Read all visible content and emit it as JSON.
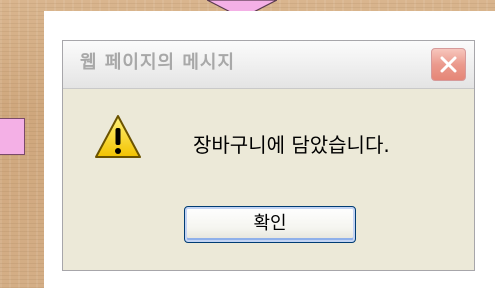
{
  "dialog": {
    "title": "웹 페이지의 메시지",
    "message": "장바구니에 담았습니다.",
    "ok_label": "확인",
    "icon": "warning-icon",
    "close_icon": "close-icon"
  },
  "colors": {
    "background": "#d4ae86",
    "pink_accent": "#f4b0e6",
    "dialog_body": "#ece9d8",
    "close_button": "#e58677",
    "title_text": "#a8a8a8"
  }
}
